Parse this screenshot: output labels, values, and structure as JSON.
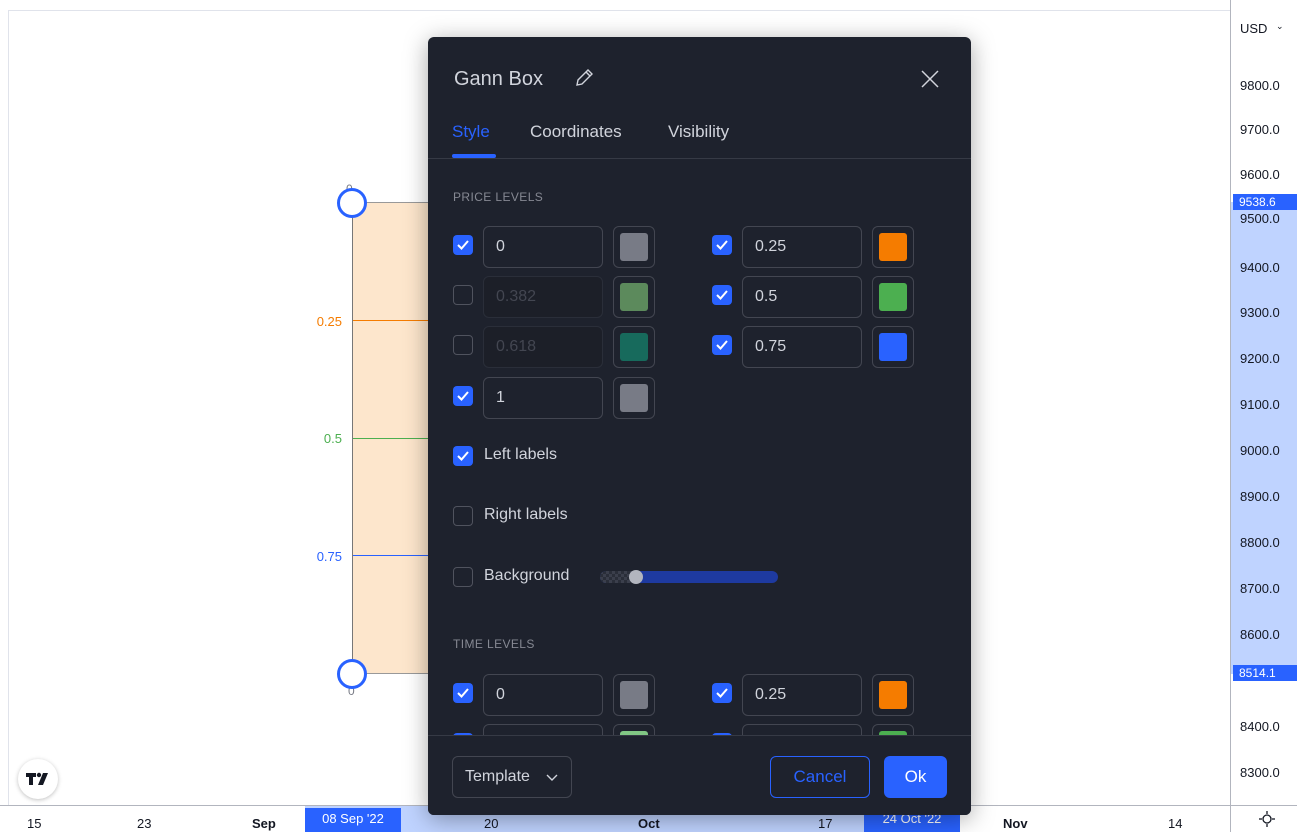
{
  "colors": {
    "accent": "#2962ff",
    "dialog_bg": "#1e222d",
    "box_fill": "#fde6cc"
  },
  "price_scale": {
    "currency": "USD",
    "currency_chevron": "chevron-down-icon",
    "ticks": [
      "9800.0",
      "9700.0",
      "9600.0",
      "9500.0",
      "9400.0",
      "9300.0",
      "9200.0",
      "9100.0",
      "9000.0",
      "8900.0",
      "8800.0",
      "8700.0",
      "8600.0",
      "8400.0",
      "8300.0"
    ],
    "badges": [
      "9538.6",
      "8514.1"
    ]
  },
  "time_scale": {
    "ticks": [
      "15",
      "23",
      "Sep",
      "20",
      "Oct",
      "17",
      "Nov",
      "14"
    ],
    "badges": [
      "08 Sep '22",
      "24 Oct '22"
    ]
  },
  "drawing": {
    "handle_label_top": "0",
    "handle_label_bottom": "0",
    "levels": [
      {
        "label": "0.25",
        "color": "#f57c00"
      },
      {
        "label": "0.5",
        "color": "#4caf50"
      },
      {
        "label": "0.75",
        "color": "#2962ff"
      }
    ]
  },
  "dialog": {
    "title": "Gann Box",
    "title_icon": "pencil-icon",
    "close_icon": "close-icon",
    "tabs": [
      "Style",
      "Coordinates",
      "Visibility"
    ],
    "active_tab": "Style",
    "price_levels_title": "PRICE LEVELS",
    "price_levels": [
      {
        "checked": true,
        "value": "0",
        "color": "#787b86"
      },
      {
        "checked": true,
        "value": "0.25",
        "color": "#f57c00"
      },
      {
        "checked": false,
        "value": "0.382",
        "color": "#5c8a5c"
      },
      {
        "checked": true,
        "value": "0.5",
        "color": "#4caf50"
      },
      {
        "checked": false,
        "value": "0.618",
        "color": "#176a5c"
      },
      {
        "checked": true,
        "value": "0.75",
        "color": "#2962ff"
      },
      {
        "checked": true,
        "value": "1",
        "color": "#787b86"
      }
    ],
    "left_labels": {
      "label": "Left labels",
      "checked": true
    },
    "right_labels": {
      "label": "Right labels",
      "checked": false
    },
    "background": {
      "label": "Background",
      "checked": false,
      "opacity_fraction": 0.2
    },
    "time_levels_title": "TIME LEVELS",
    "time_levels": [
      {
        "checked": true,
        "value": "0",
        "color": "#787b86"
      },
      {
        "checked": true,
        "value": "0.25",
        "color": "#f57c00"
      },
      {
        "checked": true,
        "value": "",
        "color": "#81c784"
      },
      {
        "checked": true,
        "value": "",
        "color": "#4caf50"
      }
    ],
    "footer": {
      "template_label": "Template",
      "template_icon": "chevron-down-icon",
      "cancel_label": "Cancel",
      "ok_label": "Ok"
    }
  },
  "logo": "tradingview-logo"
}
